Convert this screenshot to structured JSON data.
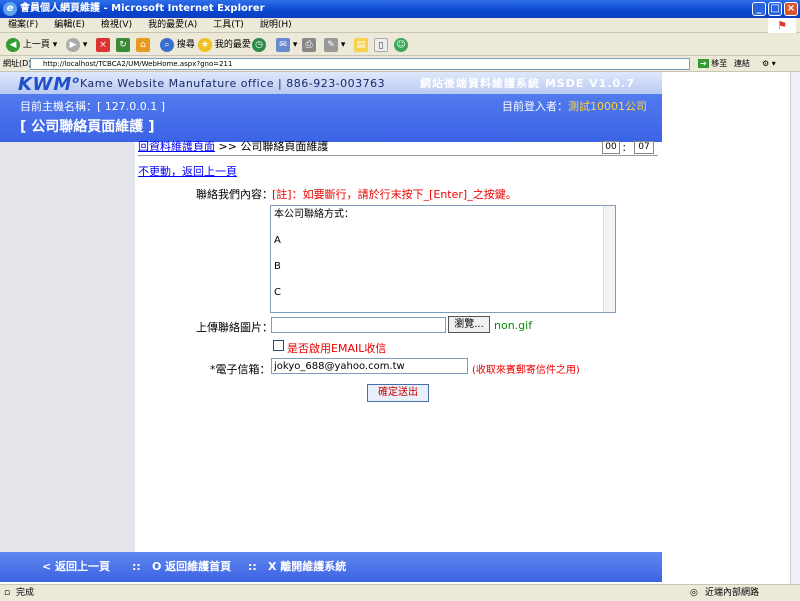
{
  "window": {
    "title": "會員個人網頁維護 - Microsoft Internet Explorer"
  },
  "menu": [
    "檔案(F)",
    "編輯(E)",
    "檢視(V)",
    "我的最愛(A)",
    "工具(T)",
    "說明(H)"
  ],
  "toolbar": {
    "back": "上一頁",
    "search": "搜尋",
    "favorites": "我的最愛"
  },
  "address": {
    "label": "網址(D)",
    "url": "http://localhost/TCBCA2/UM/WebHome.aspx?gno=211",
    "go": "移至",
    "links": "連結"
  },
  "header": {
    "logo": "KWM",
    "logo_o": "o",
    "company": "Kame Website Manufature office | 886-923-003763",
    "system_title": "網站後端資料維護系統 MSDE V1.0.7",
    "host_label": "目前主機名稱：[ 127.0.0.1 ]",
    "login_label": "目前登入者：",
    "login_user": "測試10001公司",
    "page_title": "[ 公司聯絡頁面維護 ]"
  },
  "breadcrumb": {
    "link": "回資料維護頁面",
    "sep": " >> ",
    "current": "公司聯絡頁面維護"
  },
  "counter": {
    "a": "00",
    "b": "07",
    "sep": "："
  },
  "back_link": "不更動，返回上一頁",
  "form": {
    "content_label": "聯絡我們內容：",
    "note": "[註]：如要斷行，請於行末按下_[Enter]_之按鍵。",
    "content_value": "本公司聯絡方式：\n\nA\n\nB\n\nC",
    "image_label": "上傳聯絡圖片：",
    "browse_label": "瀏覽...",
    "image_file": "non.gif",
    "email_enable_label": "是否啟用EMAIL收信",
    "email_label": "*電子信箱：",
    "email_value": "jokyo_688@yahoo.com.tw",
    "email_hint": "(收取來賓郵寄信件之用)",
    "submit": "確定送出"
  },
  "footer": {
    "back": "< 返回上一頁",
    "sep1": "::",
    "home": "O 返回維護首頁",
    "sep2": "::",
    "exit": "X 離開維護系統"
  },
  "status": {
    "left": "完成",
    "right": "近端內部網路"
  }
}
